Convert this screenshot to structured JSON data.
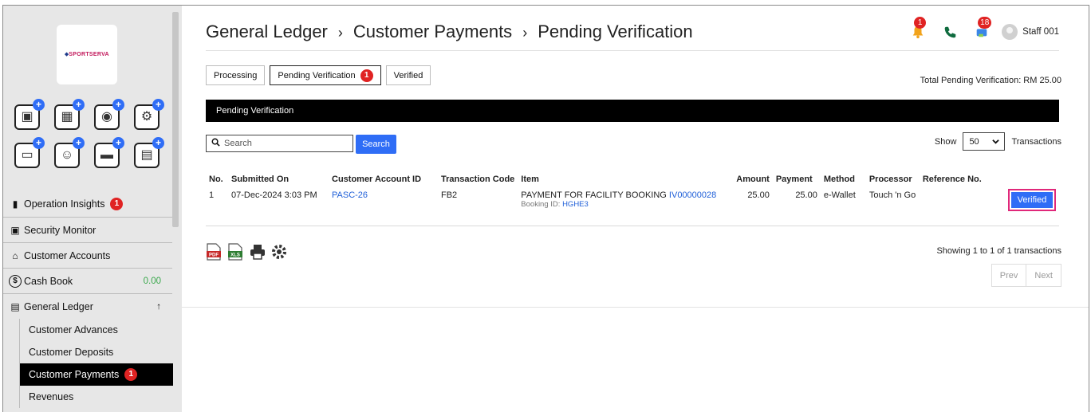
{
  "brand": {
    "logo_text": "SPORTSERVA"
  },
  "quick_actions": [
    {
      "icon": "id-card-icon",
      "glyph": "▣"
    },
    {
      "icon": "calendar-icon",
      "glyph": "▦"
    },
    {
      "icon": "cashier-icon",
      "glyph": "◉"
    },
    {
      "icon": "gym-icon",
      "glyph": "⚙"
    },
    {
      "icon": "key-card-icon",
      "glyph": "▭"
    },
    {
      "icon": "member-icon",
      "glyph": "☺"
    },
    {
      "icon": "barcode-card-icon",
      "glyph": "▬"
    },
    {
      "icon": "login-icon",
      "glyph": "▤"
    }
  ],
  "sidebar": {
    "items": [
      {
        "label": "Operation Insights",
        "icon": "chart-icon",
        "glyph": "▮",
        "badge": "1"
      },
      {
        "label": "Security Monitor",
        "icon": "monitor-icon",
        "glyph": "▣"
      },
      {
        "label": "Customer Accounts",
        "icon": "home-icon",
        "glyph": "⌂"
      },
      {
        "label": "Cash Book",
        "icon": "dollar-icon",
        "glyph": "$",
        "value": "0.00"
      },
      {
        "label": "General Ledger",
        "icon": "ledger-icon",
        "glyph": "▤",
        "arrow": "↑"
      }
    ],
    "submenu": [
      {
        "label": "Customer Advances"
      },
      {
        "label": "Customer Deposits"
      },
      {
        "label": "Customer Payments",
        "badge": "1"
      },
      {
        "label": "Revenues"
      }
    ]
  },
  "header": {
    "crumbs": [
      "General Ledger",
      "Customer Payments",
      "Pending Verification"
    ],
    "separator": "›",
    "bell_badge": "1",
    "msg_badge": "18",
    "user_name": "Staff 001"
  },
  "tabs": [
    {
      "label": "Processing"
    },
    {
      "label": "Pending Verification",
      "badge": "1"
    },
    {
      "label": "Verified"
    }
  ],
  "total_text": "Total Pending Verification: RM 25.00",
  "section_title": "Pending Verification",
  "search": {
    "placeholder": "Search",
    "button_label": "Search"
  },
  "show": {
    "label_before": "Show",
    "value": "50",
    "label_after": "Transactions"
  },
  "table": {
    "headers": [
      "No.",
      "Submitted On",
      "Customer Account ID",
      "Transaction Code",
      "Item",
      "Amount",
      "Payment",
      "Method",
      "Processor",
      "Reference No."
    ],
    "rows": [
      {
        "no": "1",
        "submitted_on": "07-Dec-2024 3:03 PM",
        "account_id": "PASC-26",
        "code": "FB2",
        "item_text": "PAYMENT FOR FACILITY BOOKING",
        "item_link": "IV00000028",
        "booking_label": "Booking ID:",
        "booking_id": "HGHE3",
        "amount": "25.00",
        "payment": "25.00",
        "method": "e-Wallet",
        "processor": "Touch 'n Go",
        "reference": "",
        "action_label": "Verified"
      }
    ]
  },
  "exports": [
    "pdf-icon",
    "xls-icon",
    "print-icon",
    "settings-icon"
  ],
  "pagination": {
    "showing": "Showing 1 to 1 of 1 transactions",
    "prev": "Prev",
    "next": "Next"
  }
}
